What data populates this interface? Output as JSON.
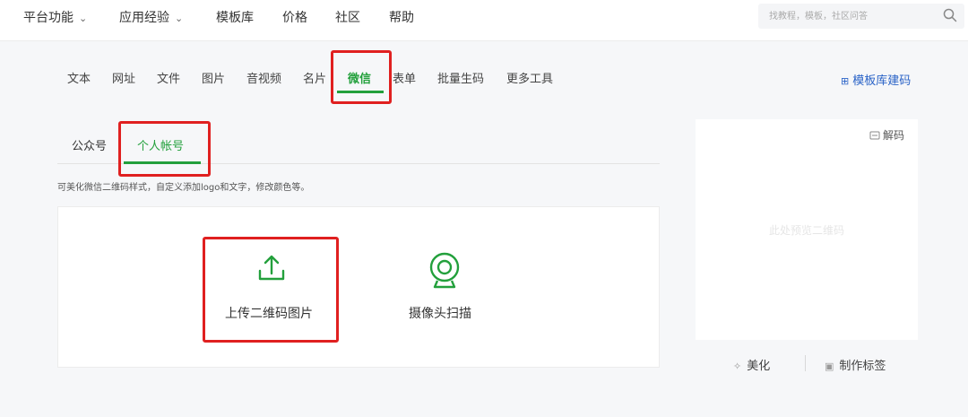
{
  "nav": {
    "platform": "平台功能",
    "experience": "应用经验",
    "templates": "模板库",
    "pricing": "价格",
    "community": "社区",
    "help": "帮助",
    "search_placeholder": "找教程，模板，社区问答",
    "search_icon": "search-icon"
  },
  "tools": {
    "tabs": [
      "文本",
      "网址",
      "文件",
      "图片",
      "音视频",
      "名片",
      "微信",
      "表单",
      "批量生码",
      "更多工具"
    ],
    "active_tab": "微信",
    "template_link": "模板库建码"
  },
  "wechat": {
    "sub_tabs": [
      "公众号",
      "个人帐号"
    ],
    "active_sub_tab": "个人帐号",
    "hint": "可美化微信二维码样式，自定义添加logo和文字，修改颜色等。",
    "upload_label": "上传二维码图片",
    "camera_label": "摄像头扫描"
  },
  "preview": {
    "decode": "解码",
    "placeholder": "此处预览二维码",
    "beautify": "美化",
    "make_label": "制作标签"
  },
  "colors": {
    "accent": "#23a03c",
    "highlight": "#e02020",
    "link": "#2a63c7"
  }
}
